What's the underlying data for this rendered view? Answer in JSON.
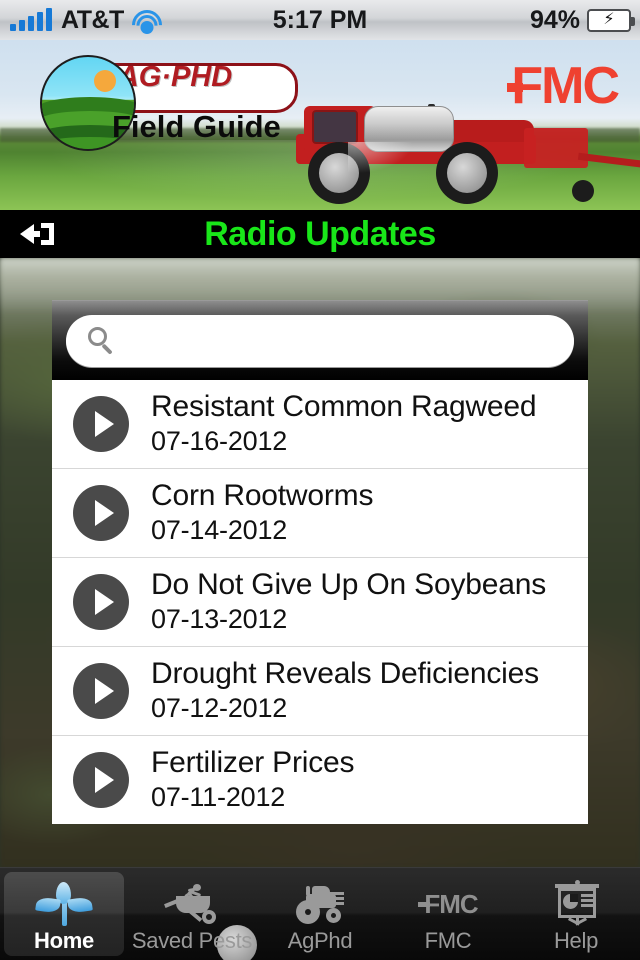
{
  "status_bar": {
    "signal_icon": "signal-bars-icon",
    "carrier": "AT&T",
    "wifi_icon": "wifi-icon",
    "time": "5:17 PM",
    "battery_percent": "94%",
    "battery_icon": "battery-charging-icon"
  },
  "banner": {
    "logo_badge_text": "AG·PHD",
    "logo_subtitle": "Field Guide",
    "brand_logo": "FMC",
    "photo_alt": "red-sprayer-in-green-field"
  },
  "titlebar": {
    "back_icon": "back-arrow-icon",
    "title": "Radio Updates",
    "title_color": "#19e619"
  },
  "search": {
    "icon": "search-icon",
    "value": "",
    "placeholder": ""
  },
  "list": {
    "items": [
      {
        "play_icon": "play-icon",
        "title": "Resistant Common Ragweed",
        "date": "07-16-2012"
      },
      {
        "play_icon": "play-icon",
        "title": "Corn Rootworms",
        "date": "07-14-2012"
      },
      {
        "play_icon": "play-icon",
        "title": "Do Not Give Up On Soybeans",
        "date": "07-13-2012"
      },
      {
        "play_icon": "play-icon",
        "title": "Drought Reveals Deficiencies",
        "date": "07-12-2012"
      },
      {
        "play_icon": "play-icon",
        "title": "Fertilizer Prices",
        "date": "07-11-2012"
      }
    ]
  },
  "tabbar": {
    "active": "Home",
    "items": [
      {
        "label": "Home",
        "icon": "sprout-icon"
      },
      {
        "label": "Saved Pests",
        "icon": "wheelbarrow-icon"
      },
      {
        "label": "AgPhd",
        "icon": "tractor-icon"
      },
      {
        "label": "FMC",
        "icon": "fmc-logo-icon"
      },
      {
        "label": "Help",
        "icon": "presentation-chart-icon"
      }
    ]
  },
  "colors": {
    "title_green": "#19e619",
    "fmc_red": "#ef4130",
    "agphd_red": "#b01c22",
    "play_gray": "#4a4a4a"
  }
}
